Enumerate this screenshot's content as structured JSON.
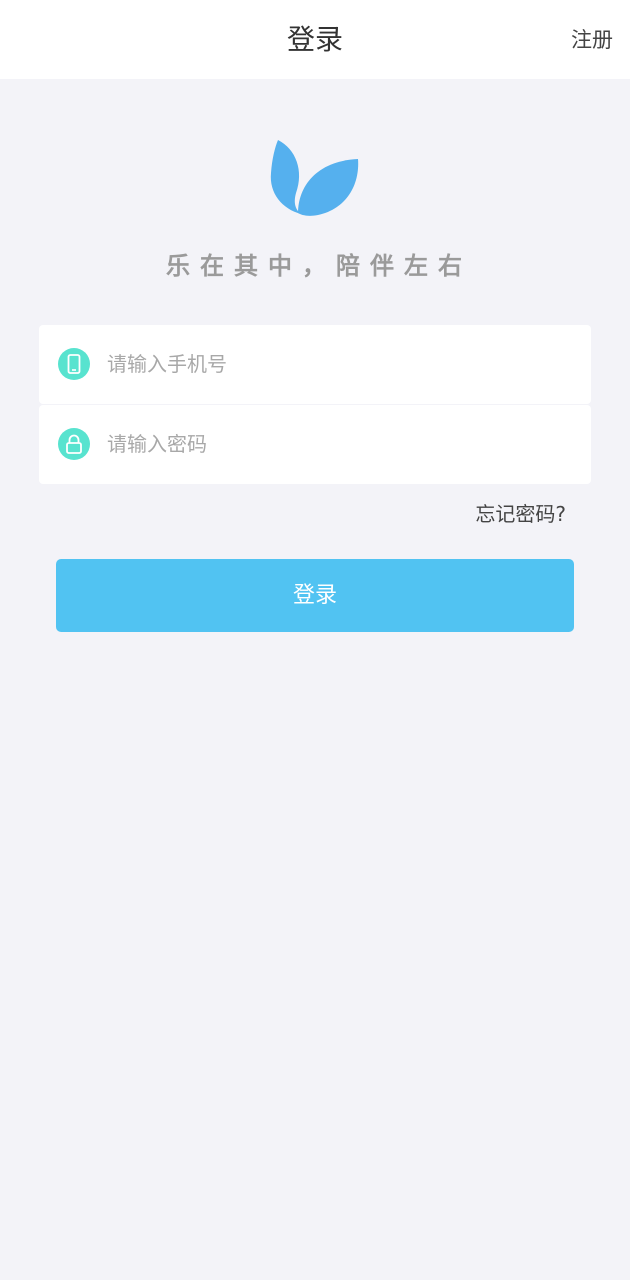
{
  "header": {
    "title": "登录",
    "register_label": "注册"
  },
  "logo": {
    "icon": "leaf-logo-icon",
    "color": "#55b0ee"
  },
  "slogan": "乐在其中，陪伴左右",
  "form": {
    "phone": {
      "icon": "phone-icon",
      "value": "",
      "placeholder": "请输入手机号"
    },
    "password": {
      "icon": "lock-icon",
      "value": "",
      "placeholder": "请输入密码"
    },
    "forgot_label": "忘记密码?",
    "submit_label": "登录"
  },
  "colors": {
    "background": "#f3f3f8",
    "icon_accent": "#58e3cf",
    "button": "#51c3f2"
  }
}
